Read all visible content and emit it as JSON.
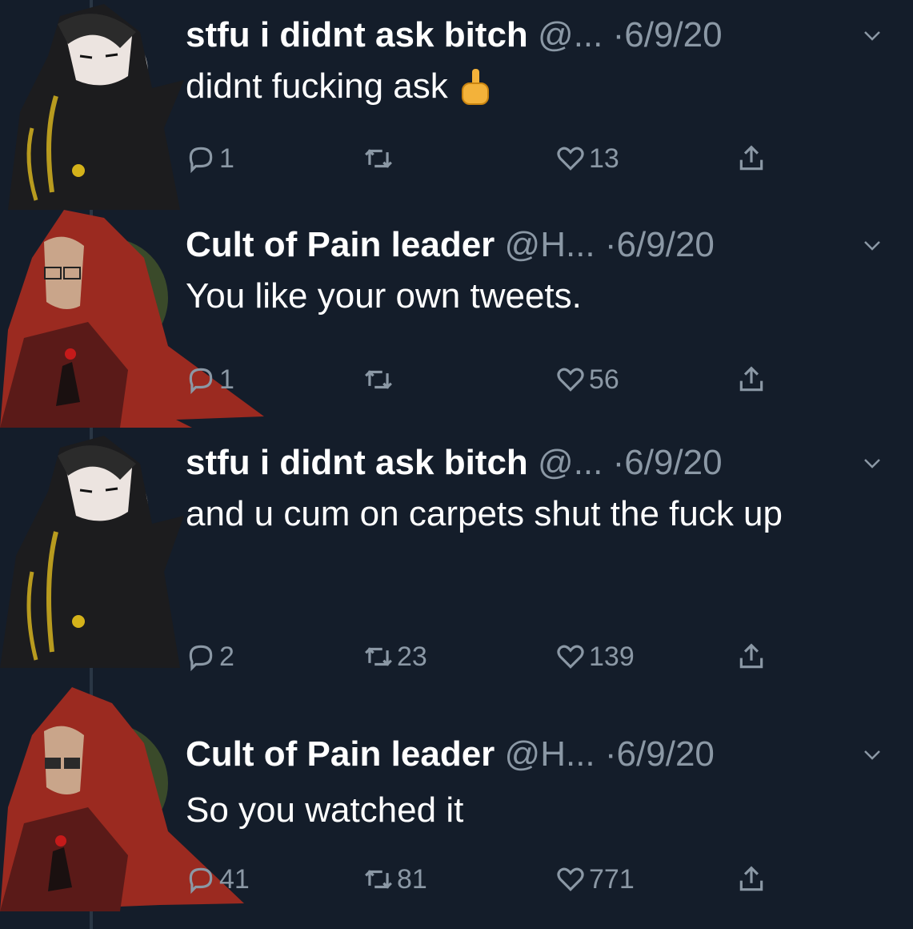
{
  "tweets": [
    {
      "name": "stfu i didnt ask bitch",
      "handle": "@...",
      "dot": "·",
      "date": "6/9/20",
      "text": "didnt fucking ask",
      "emoji": "middle-finger",
      "replies": "1",
      "retweets": "",
      "likes": "13",
      "avatar": "dark-haired-anime-character"
    },
    {
      "name": "Cult of Pain leader",
      "handle": "@H...",
      "dot": "·",
      "date": "6/9/20",
      "text": "You like your own tweets.",
      "replies": "1",
      "retweets": "",
      "likes": "56",
      "avatar": "red-haired-anime-character"
    },
    {
      "name": "stfu i didnt ask bitch",
      "handle": "@...",
      "dot": "·",
      "date": "6/9/20",
      "text": "and u cum on carpets shut the fuck up",
      "replies": "2",
      "retweets": "23",
      "likes": "139",
      "avatar": "dark-haired-anime-character"
    },
    {
      "name": "Cult of Pain leader",
      "handle": "@H...",
      "dot": "·",
      "date": "6/9/20",
      "text": "So you watched it",
      "replies": "41",
      "retweets": "81",
      "likes": "771",
      "avatar": "red-haired-anime-character"
    }
  ],
  "colors": {
    "background": "#141d2a",
    "muted": "#8b98a5",
    "text": "#ffffff"
  }
}
